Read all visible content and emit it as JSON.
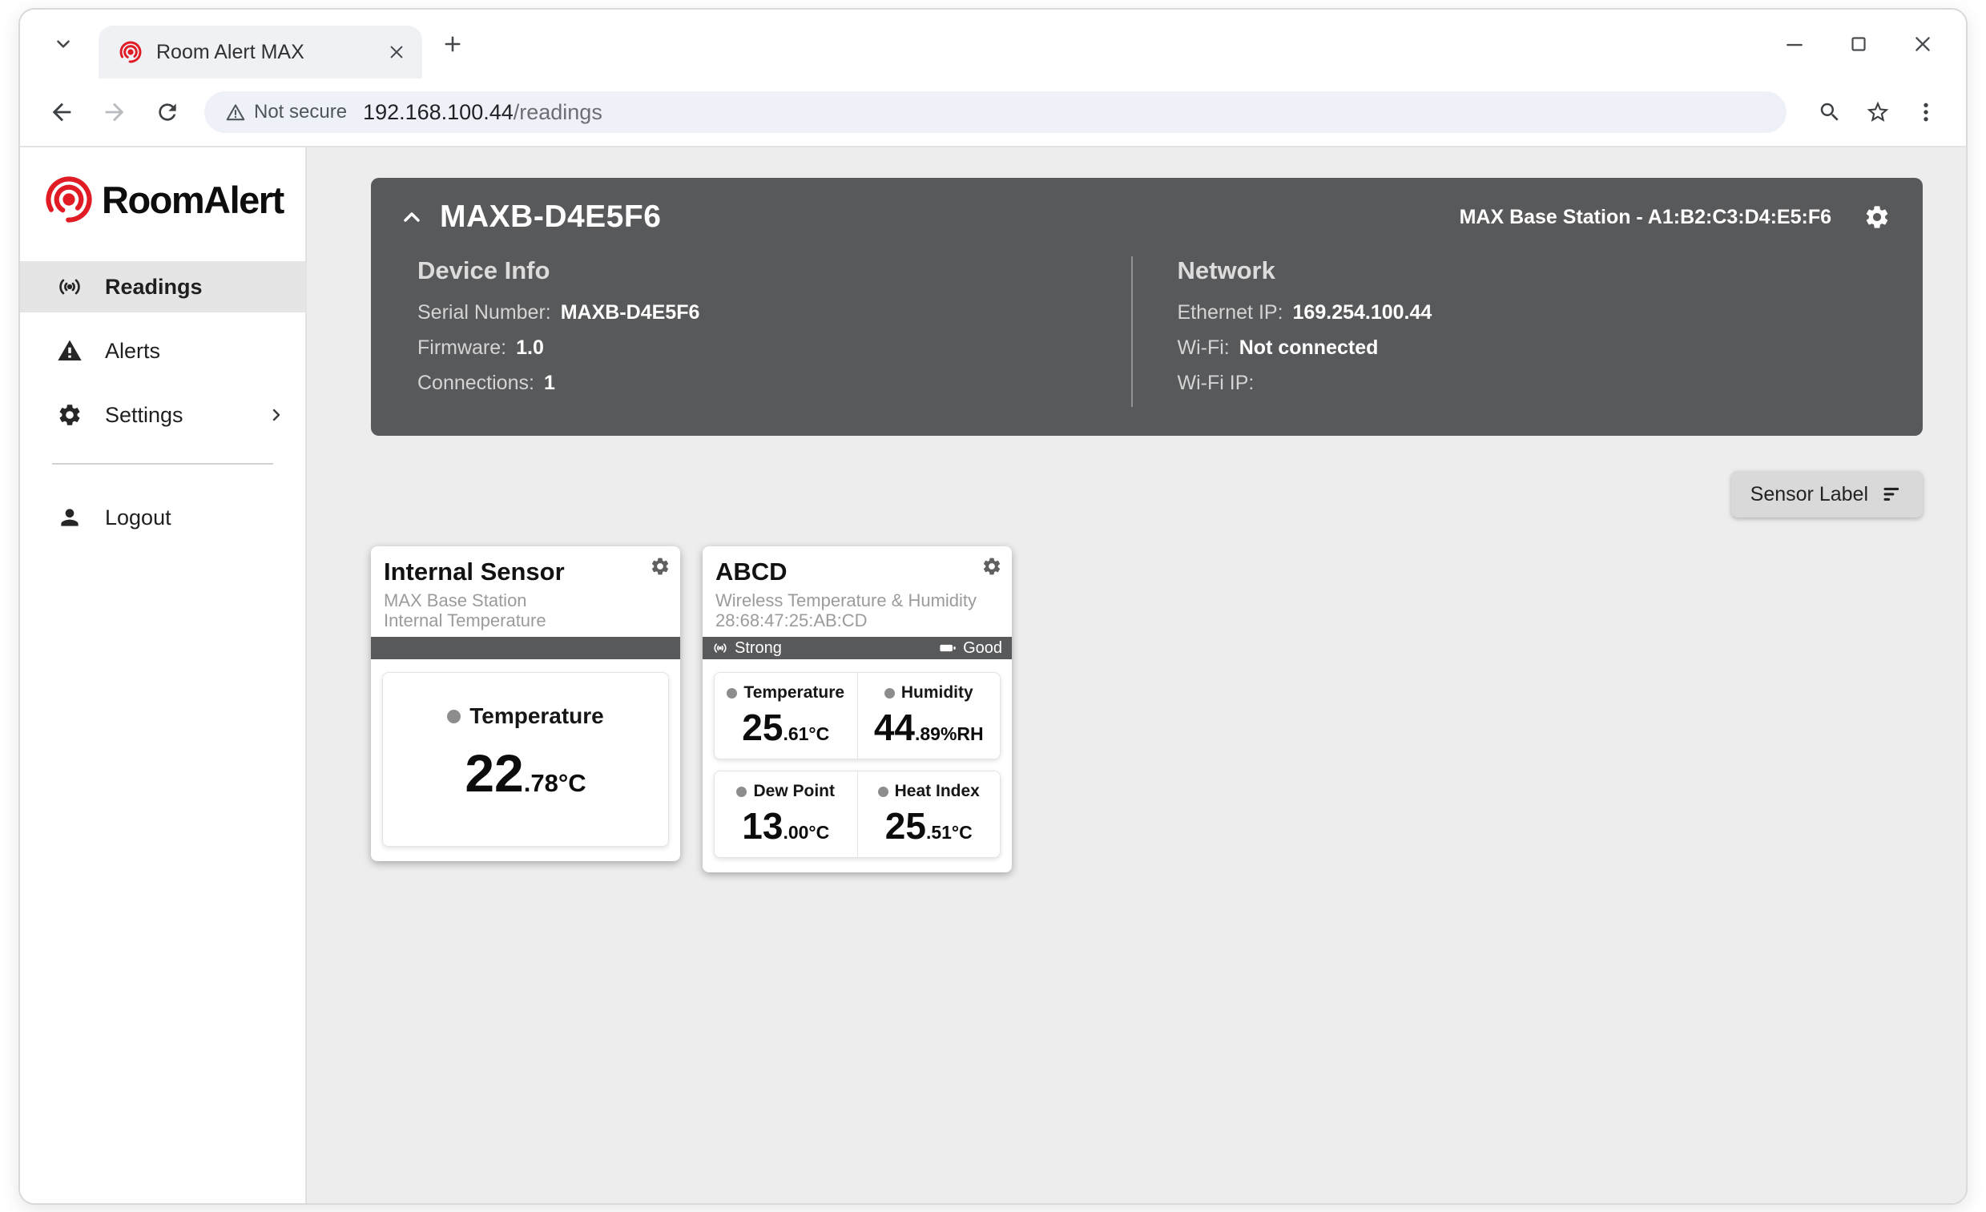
{
  "browser": {
    "tab_title": "Room Alert MAX",
    "address": {
      "security_label": "Not secure",
      "host": "192.168.100.44",
      "path": "/readings"
    }
  },
  "sidebar": {
    "brand": {
      "part1": "Room",
      "part2": "Alert"
    },
    "items": [
      {
        "label": "Readings"
      },
      {
        "label": "Alerts"
      },
      {
        "label": "Settings"
      }
    ],
    "logout_label": "Logout"
  },
  "device": {
    "title": "MAXB-D4E5F6",
    "model_line": "MAX Base Station - A1:B2:C3:D4:E5:F6",
    "info": {
      "heading": "Device Info",
      "serial_label": "Serial Number:",
      "serial_value": "MAXB-D4E5F6",
      "firmware_label": "Firmware:",
      "firmware_value": "1.0",
      "connections_label": "Connections:",
      "connections_value": "1"
    },
    "network": {
      "heading": "Network",
      "ethernet_label": "Ethernet IP:",
      "ethernet_value": "169.254.100.44",
      "wifi_label": "Wi-Fi:",
      "wifi_value": "Not connected",
      "wifi_ip_label": "Wi-Fi IP:",
      "wifi_ip_value": ""
    }
  },
  "toolbar": {
    "sort_label": "Sensor Label"
  },
  "sensors": [
    {
      "name": "Internal Sensor",
      "line1": "MAX Base Station",
      "line2": "Internal Temperature",
      "readings": [
        {
          "label": "Temperature",
          "int": "22",
          "rest": ".78°C"
        }
      ]
    },
    {
      "name": "ABCD",
      "line1": "Wireless Temperature & Humidity",
      "line2": "28:68:47:25:AB:CD",
      "signal": "Strong",
      "battery": "Good",
      "readings": [
        {
          "label": "Temperature",
          "int": "25",
          "rest": ".61°C"
        },
        {
          "label": "Humidity",
          "int": "44",
          "rest": ".89%RH"
        },
        {
          "label": "Dew Point",
          "int": "13",
          "rest": ".00°C"
        },
        {
          "label": "Heat Index",
          "int": "25",
          "rest": ".51°C"
        }
      ]
    }
  ],
  "colors": {
    "brand_red": "#e01b24",
    "panel_dark": "#58595b",
    "page_bg": "#ededee"
  }
}
